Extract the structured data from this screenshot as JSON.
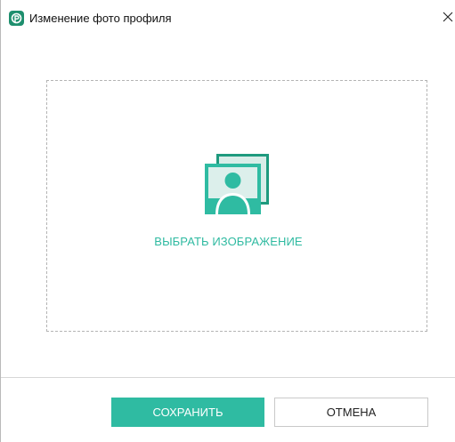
{
  "window": {
    "title": "Изменение фото профиля",
    "close_glyph": "×"
  },
  "upload": {
    "choose_image_label": "ВЫБРАТЬ ИЗОБРАЖЕНИЕ",
    "icon": "image-gallery-icon"
  },
  "footer": {
    "save_label": "СОХРАНИТЬ",
    "cancel_label": "ОТМЕНА"
  },
  "colors": {
    "accent": "#2fbba2",
    "accent_dark": "#1e8f6e",
    "dash_border": "#b4b4b4"
  }
}
